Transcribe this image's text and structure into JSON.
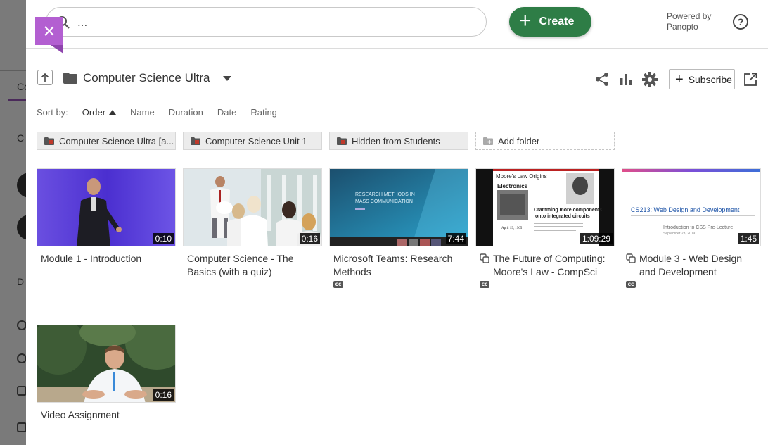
{
  "search": {
    "placeholder": "..."
  },
  "create_label": "Create",
  "powered_by": {
    "line1": "Powered by",
    "line2": "Panopto"
  },
  "folder": {
    "title": "Computer Science Ultra"
  },
  "subscribe_label": "Subscribe",
  "sort": {
    "label": "Sort by:",
    "options": [
      "Order",
      "Name",
      "Duration",
      "Date",
      "Rating"
    ],
    "active": "Order"
  },
  "folders": [
    {
      "name": "Computer Science Ultra [a..."
    },
    {
      "name": "Computer Science Unit 1"
    },
    {
      "name": "Hidden from Students"
    }
  ],
  "add_folder_label": "Add folder",
  "videos": [
    {
      "title": "Module 1 - Introduction",
      "duration": "0:10",
      "captions": false,
      "linked": false
    },
    {
      "title": "Computer Science - The Basics (with a quiz)",
      "duration": "0:16",
      "captions": false,
      "linked": false
    },
    {
      "title": "Microsoft Teams: Research Methods",
      "duration": "7:44",
      "captions": true,
      "linked": false
    },
    {
      "title": "The Future of Computing: Moore's Law - CompSci",
      "duration": "1:09:29",
      "captions": true,
      "linked": true
    },
    {
      "title": "Module 3 - Web Design and Development",
      "duration": "1:45",
      "captions": true,
      "linked": true
    },
    {
      "title": "Video Assignment",
      "duration": "0:16",
      "captions": false,
      "linked": false
    }
  ],
  "thumb_text": {
    "research_title_1": "RESEARCH METHODS IN",
    "research_title_2": "MASS COMMUNICATION",
    "moore_heading": "Moore's Law Origins",
    "moore_sub": "Electronics",
    "moore_caption_1": "Cramming more components",
    "moore_caption_2": "onto integrated circuits",
    "moore_date": "April 19, 1965",
    "web_title": "CS213: Web Design and Development",
    "web_sub": "Introduction to CSS Pre-Lecture",
    "web_date": "September 23, 2019"
  },
  "cc_label": "CC",
  "colors": {
    "accent_purple": "#b35fd1",
    "create_green": "#2e7d46",
    "folder_red": "#c0392b"
  },
  "icons": [
    "close-icon",
    "search-icon",
    "plus-icon",
    "help-icon",
    "up-arrow-icon",
    "folder-icon",
    "dropdown-caret-icon",
    "share-icon",
    "stats-icon",
    "settings-icon",
    "external-link-icon",
    "linked-session-icon",
    "captions-icon"
  ]
}
